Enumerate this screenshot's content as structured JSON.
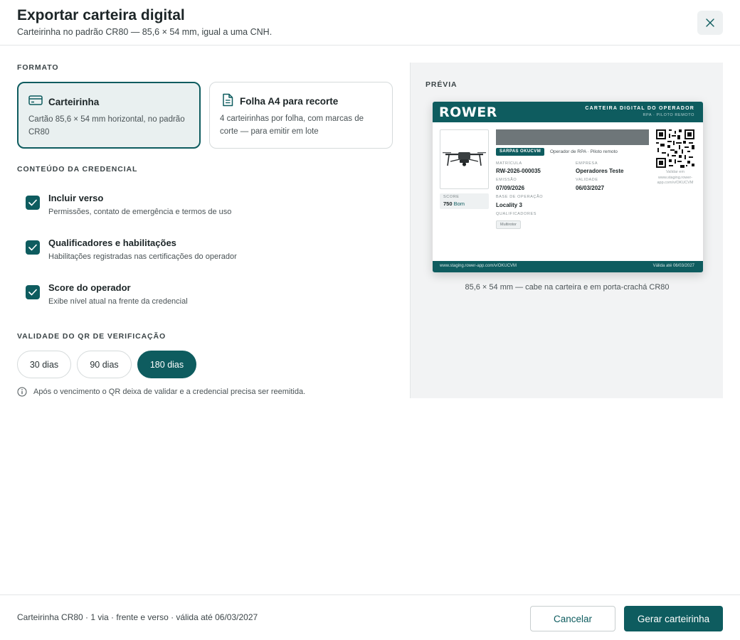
{
  "dialog": {
    "title": "Exportar carteira digital",
    "subtitle": "Carteirinha no padrão CR80 — 85,6 × 54 mm, igual a uma CNH.",
    "close_icon": "close-icon"
  },
  "format": {
    "label": "FORMATO",
    "options": [
      {
        "title": "Carteirinha",
        "description": "Cartão 85,6 × 54 mm horizontal, no padrão CR80",
        "icon": "card-icon",
        "selected": true
      },
      {
        "title": "Folha A4 para recorte",
        "description": "4 carteirinhas por folha, com marcas de corte — para emitir em lote",
        "icon": "document-icon",
        "selected": false
      }
    ]
  },
  "content": {
    "label": "CONTEÚDO DA CREDENCIAL",
    "options": [
      {
        "title": "Incluir verso",
        "description": "Permissões, contato de emergência e termos de uso",
        "checked": true
      },
      {
        "title": "Qualificadores e habilitações",
        "description": "Habilitações registradas nas certificações do operador",
        "checked": true
      },
      {
        "title": "Score do operador",
        "description": "Exibe nível atual na frente da credencial",
        "checked": true
      }
    ]
  },
  "qr_validity": {
    "label": "VALIDADE DO QR DE VERIFICAÇÃO",
    "options": [
      "30 dias",
      "90 dias",
      "180 dias"
    ],
    "selected": "180 dias",
    "info": "Após o vencimento o QR deixa de validar e a credencial precisa ser reemitida.",
    "info_icon": "info-icon"
  },
  "preview": {
    "label": "PRÉVIA",
    "caption": "85,6 × 54 mm — cabe na carteira e em porta-crachá CR80",
    "card": {
      "brand": "ROWER",
      "heading": "CARTEIRA DIGITAL DO OPERADOR",
      "subheading": "RPA · PILOTO REMOTO",
      "score_label": "SCORE",
      "score_value": "750",
      "score_rating": "Bom",
      "badge": "SARPAS OKUCVM",
      "role": "Operador de RPA · Piloto remoto",
      "fields": {
        "matricula_label": "MATRÍCULA",
        "matricula": "RW-2026-000035",
        "empresa_label": "EMPRESA",
        "empresa": "Operadores Teste",
        "emissao_label": "EMISSÃO",
        "emissao": "07/09/2026",
        "validade_label": "VALIDADE",
        "validade": "06/03/2027",
        "base_label": "BASE DE OPERAÇÃO",
        "base": "Locality 3",
        "qualificadores_label": "QUALIFICADORES",
        "qualificador": "Multirotor"
      },
      "qr_caption": "Validar em www.staging.rower-app.com/v/OKUCVM",
      "footer_url": "www.staging.rower-app.com/v/OKUCVM",
      "footer_valid": "Válida até 06/03/2027"
    }
  },
  "footer": {
    "summary": "Carteirinha CR80 · 1 via · frente e verso · válida até 06/03/2027",
    "cancel_label": "Cancelar",
    "generate_label": "Gerar carteirinha"
  },
  "colors": {
    "accent": "#0e5c5f",
    "selected_card_bg": "#e9f0f0",
    "panel_bg": "#f2f3f4"
  }
}
